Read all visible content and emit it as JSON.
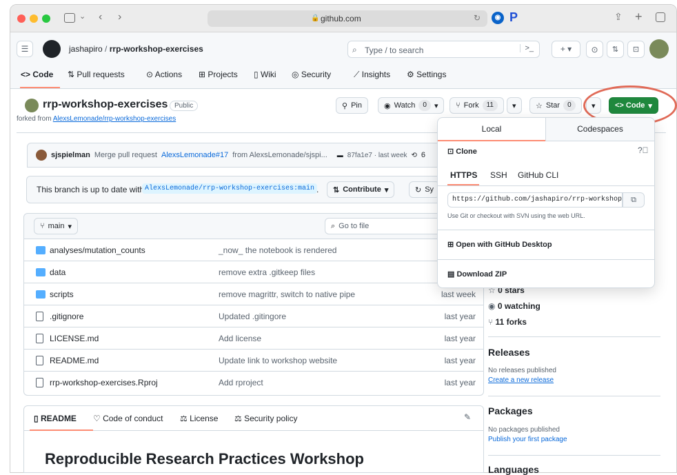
{
  "browser": {
    "url": "github.com"
  },
  "header": {
    "owner": "jashapiro",
    "separator": "/",
    "repo": "rrp-workshop-exercises",
    "search_placeholder": "Type / to search",
    "plus": "+ ▾"
  },
  "nav": {
    "tabs": [
      "Code",
      "Pull requests",
      "Actions",
      "Projects",
      "Wiki",
      "Security",
      "Insights",
      "Settings"
    ]
  },
  "repo": {
    "name": "rrp-workshop-exercises",
    "visibility": "Public",
    "forked_prefix": "forked from",
    "forked_link": "AlexsLemonade/rrp-workshop-exercises",
    "pin": "Pin",
    "watch": "Watch",
    "watch_count": "0",
    "fork": "Fork",
    "fork_count": "11",
    "star": "Star",
    "star_count": "0",
    "code_btn": "<> Code"
  },
  "commit": {
    "author": "sjspielman",
    "msg_prefix": "Merge pull request",
    "pr_link": "AlexsLemonade#17",
    "msg_suffix": "from AlexsLemonade/sjspi...",
    "hash": "87fa1e7 · last week",
    "history": "6"
  },
  "branch_status": {
    "text": "This branch is up to date with",
    "ref": "AlexsLemonade/rrp-workshop-exercises:main",
    "period": ".",
    "contribute": "Contribute",
    "sync": "Sy"
  },
  "toolbar": {
    "branch": "main",
    "goto": "Go to file"
  },
  "files": [
    {
      "name": "analyses/mutation_counts",
      "msg": "_now_ the notebook is rendered",
      "time": "",
      "type": "folder"
    },
    {
      "name": "data",
      "msg": "remove extra .gitkeep files",
      "time": "",
      "type": "folder"
    },
    {
      "name": "scripts",
      "msg": "remove magrittr, switch to native pipe",
      "time": "last week",
      "type": "folder"
    },
    {
      "name": ".gitignore",
      "msg": "Updated .gitingore",
      "time": "last year",
      "type": "file"
    },
    {
      "name": "LICENSE.md",
      "msg": "Add license",
      "time": "last year",
      "type": "file"
    },
    {
      "name": "README.md",
      "msg": "Update link to workshop website",
      "time": "last year",
      "type": "file"
    },
    {
      "name": "rrp-workshop-exercises.Rproj",
      "msg": "Add rproject",
      "time": "last year",
      "type": "file"
    }
  ],
  "readme": {
    "tabs": [
      "README",
      "Code of conduct",
      "License",
      "Security policy"
    ],
    "heading": "Reproducible Research Practices Workshop"
  },
  "sidebar": {
    "stars": "0 stars",
    "watching": "0 watching",
    "forks": "11 forks",
    "releases_title": "Releases",
    "releases_none": "No releases published",
    "releases_link": "Create a new release",
    "packages_title": "Packages",
    "packages_none": "No packages published",
    "packages_link": "Publish your first package",
    "languages_title": "Languages"
  },
  "dropdown": {
    "tabs": [
      "Local",
      "Codespaces"
    ],
    "clone": "Clone",
    "protocols": [
      "HTTPS",
      "SSH",
      "GitHub CLI"
    ],
    "url": "https://github.com/jashapiro/rrp-workshop-exercises.git",
    "help": "Use Git or checkout with SVN using the web URL.",
    "desktop": "Open with GitHub Desktop",
    "zip": "Download ZIP"
  },
  "colors": {
    "green": "#1f883d",
    "highlight": "#e06a57",
    "link": "#0969da"
  }
}
